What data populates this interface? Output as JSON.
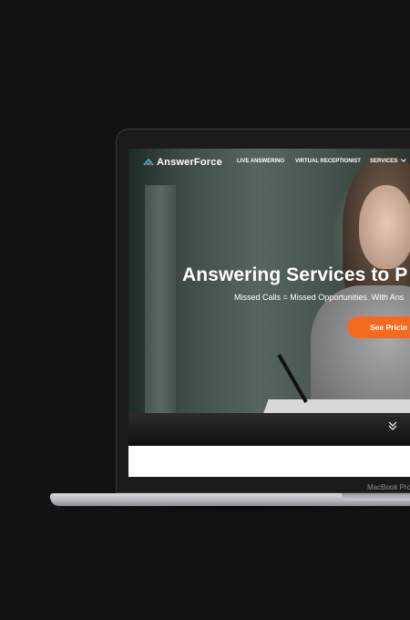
{
  "device": {
    "brand_label": "MacBook Pro"
  },
  "site": {
    "logo_text": "AnswerForce",
    "nav": [
      "LIVE ANSWERING",
      "VIRTUAL RECEPTIONIST",
      "SERVICES"
    ],
    "headline": "Answering Services to P",
    "subheadline": "Missed Calls = Missed Opportunities. With Ans",
    "cta_label": "See Pricin"
  },
  "colors": {
    "accent": "#f46a1f",
    "logo_blue": "#2aa8e0",
    "background": "#121212"
  },
  "icons": {
    "nav_dropdown": "chevron-down-icon",
    "scroll": "scroll-down-chevron-icon",
    "logo": "answerforce-logo-icon"
  }
}
